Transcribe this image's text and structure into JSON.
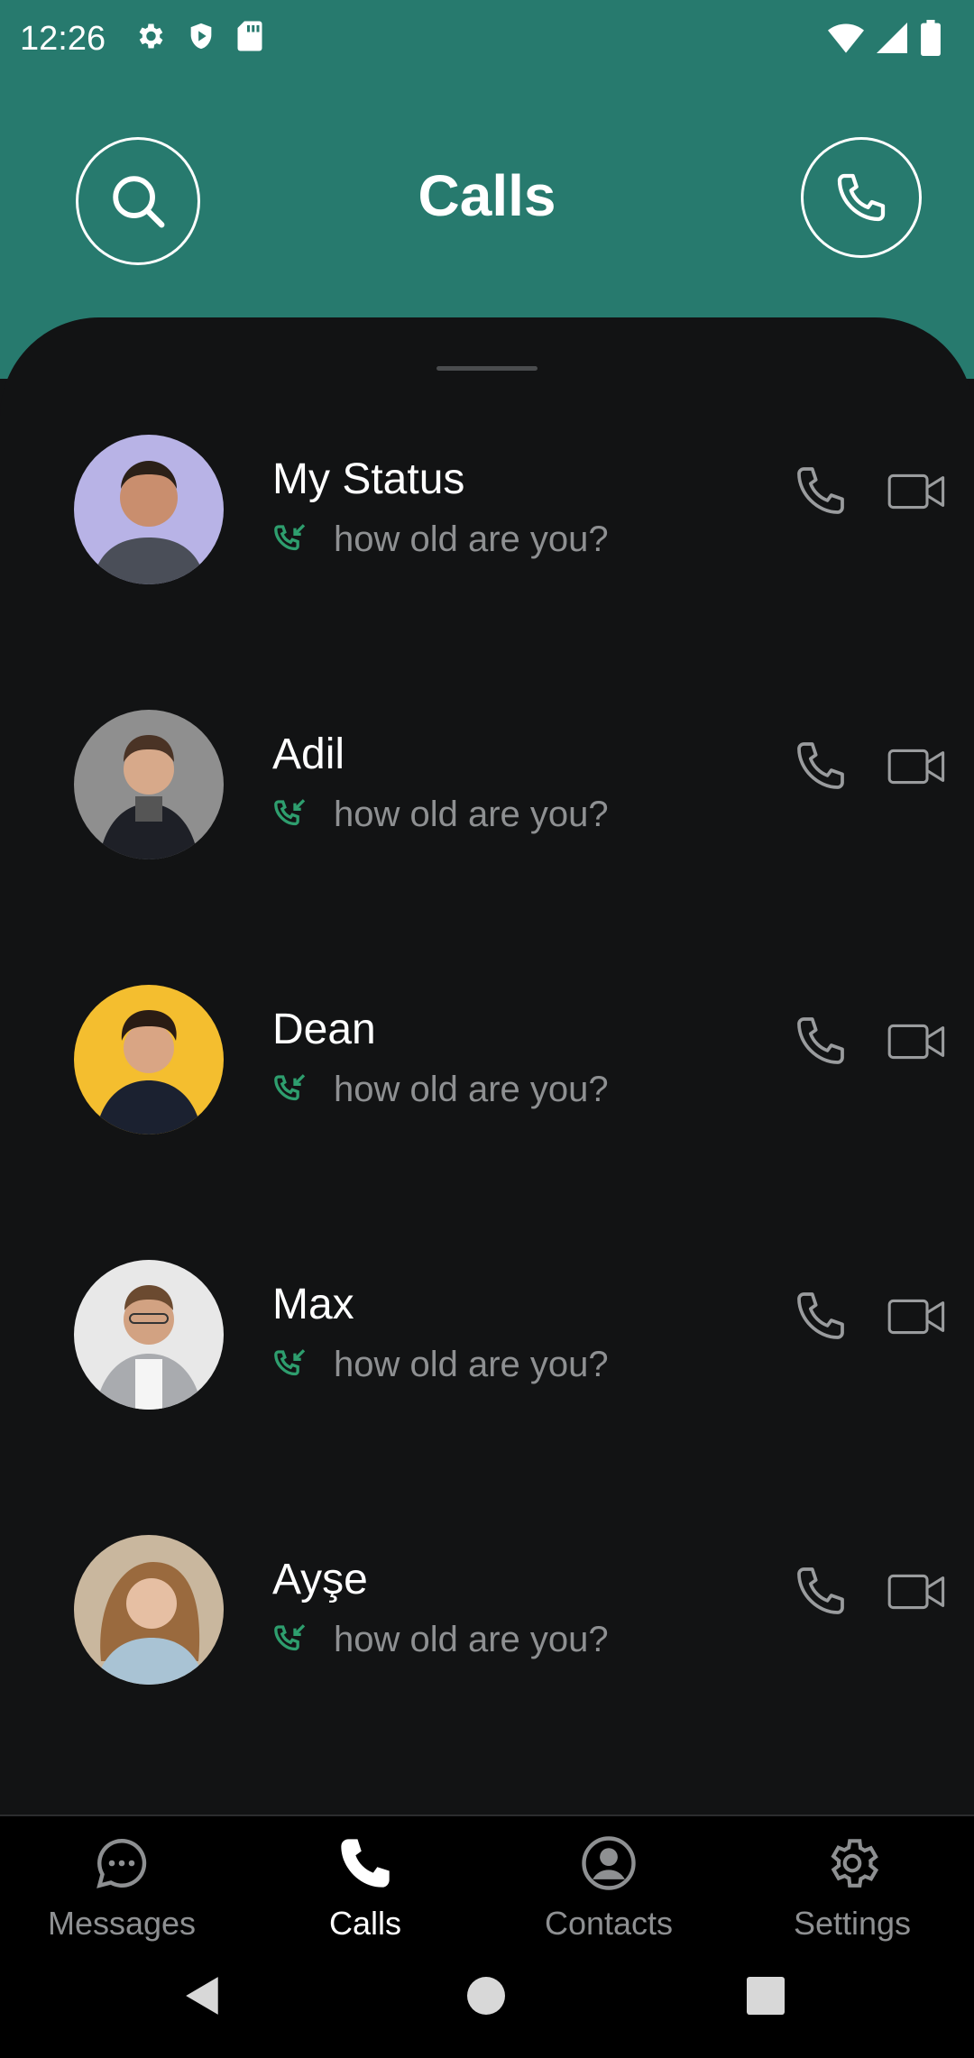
{
  "status_bar": {
    "time": "12:26"
  },
  "header": {
    "title": "Calls"
  },
  "calls": [
    {
      "name": "My Status",
      "message": "how old are you?",
      "avatar_bg": "#B8B3E6"
    },
    {
      "name": "Adil",
      "message": "how old are you?",
      "avatar_bg": "#8F8F8F"
    },
    {
      "name": "Dean",
      "message": "how old are you?",
      "avatar_bg": "#F4BE2F"
    },
    {
      "name": "Max",
      "message": "how old are you?",
      "avatar_bg": "#E8E8E8"
    },
    {
      "name": "Ayşe",
      "message": "how old are you?",
      "avatar_bg": "#C9B79E"
    }
  ],
  "nav": [
    {
      "label": "Messages",
      "icon": "chat-bubble-icon",
      "active": false
    },
    {
      "label": "Calls",
      "icon": "phone-icon",
      "active": true
    },
    {
      "label": "Contacts",
      "icon": "account-circle-icon",
      "active": false
    },
    {
      "label": "Settings",
      "icon": "gear-icon",
      "active": false
    }
  ],
  "colors": {
    "header": "#277A6E",
    "background": "#121314",
    "accent_green": "#2E9E6E",
    "muted_text": "#8E9092"
  }
}
